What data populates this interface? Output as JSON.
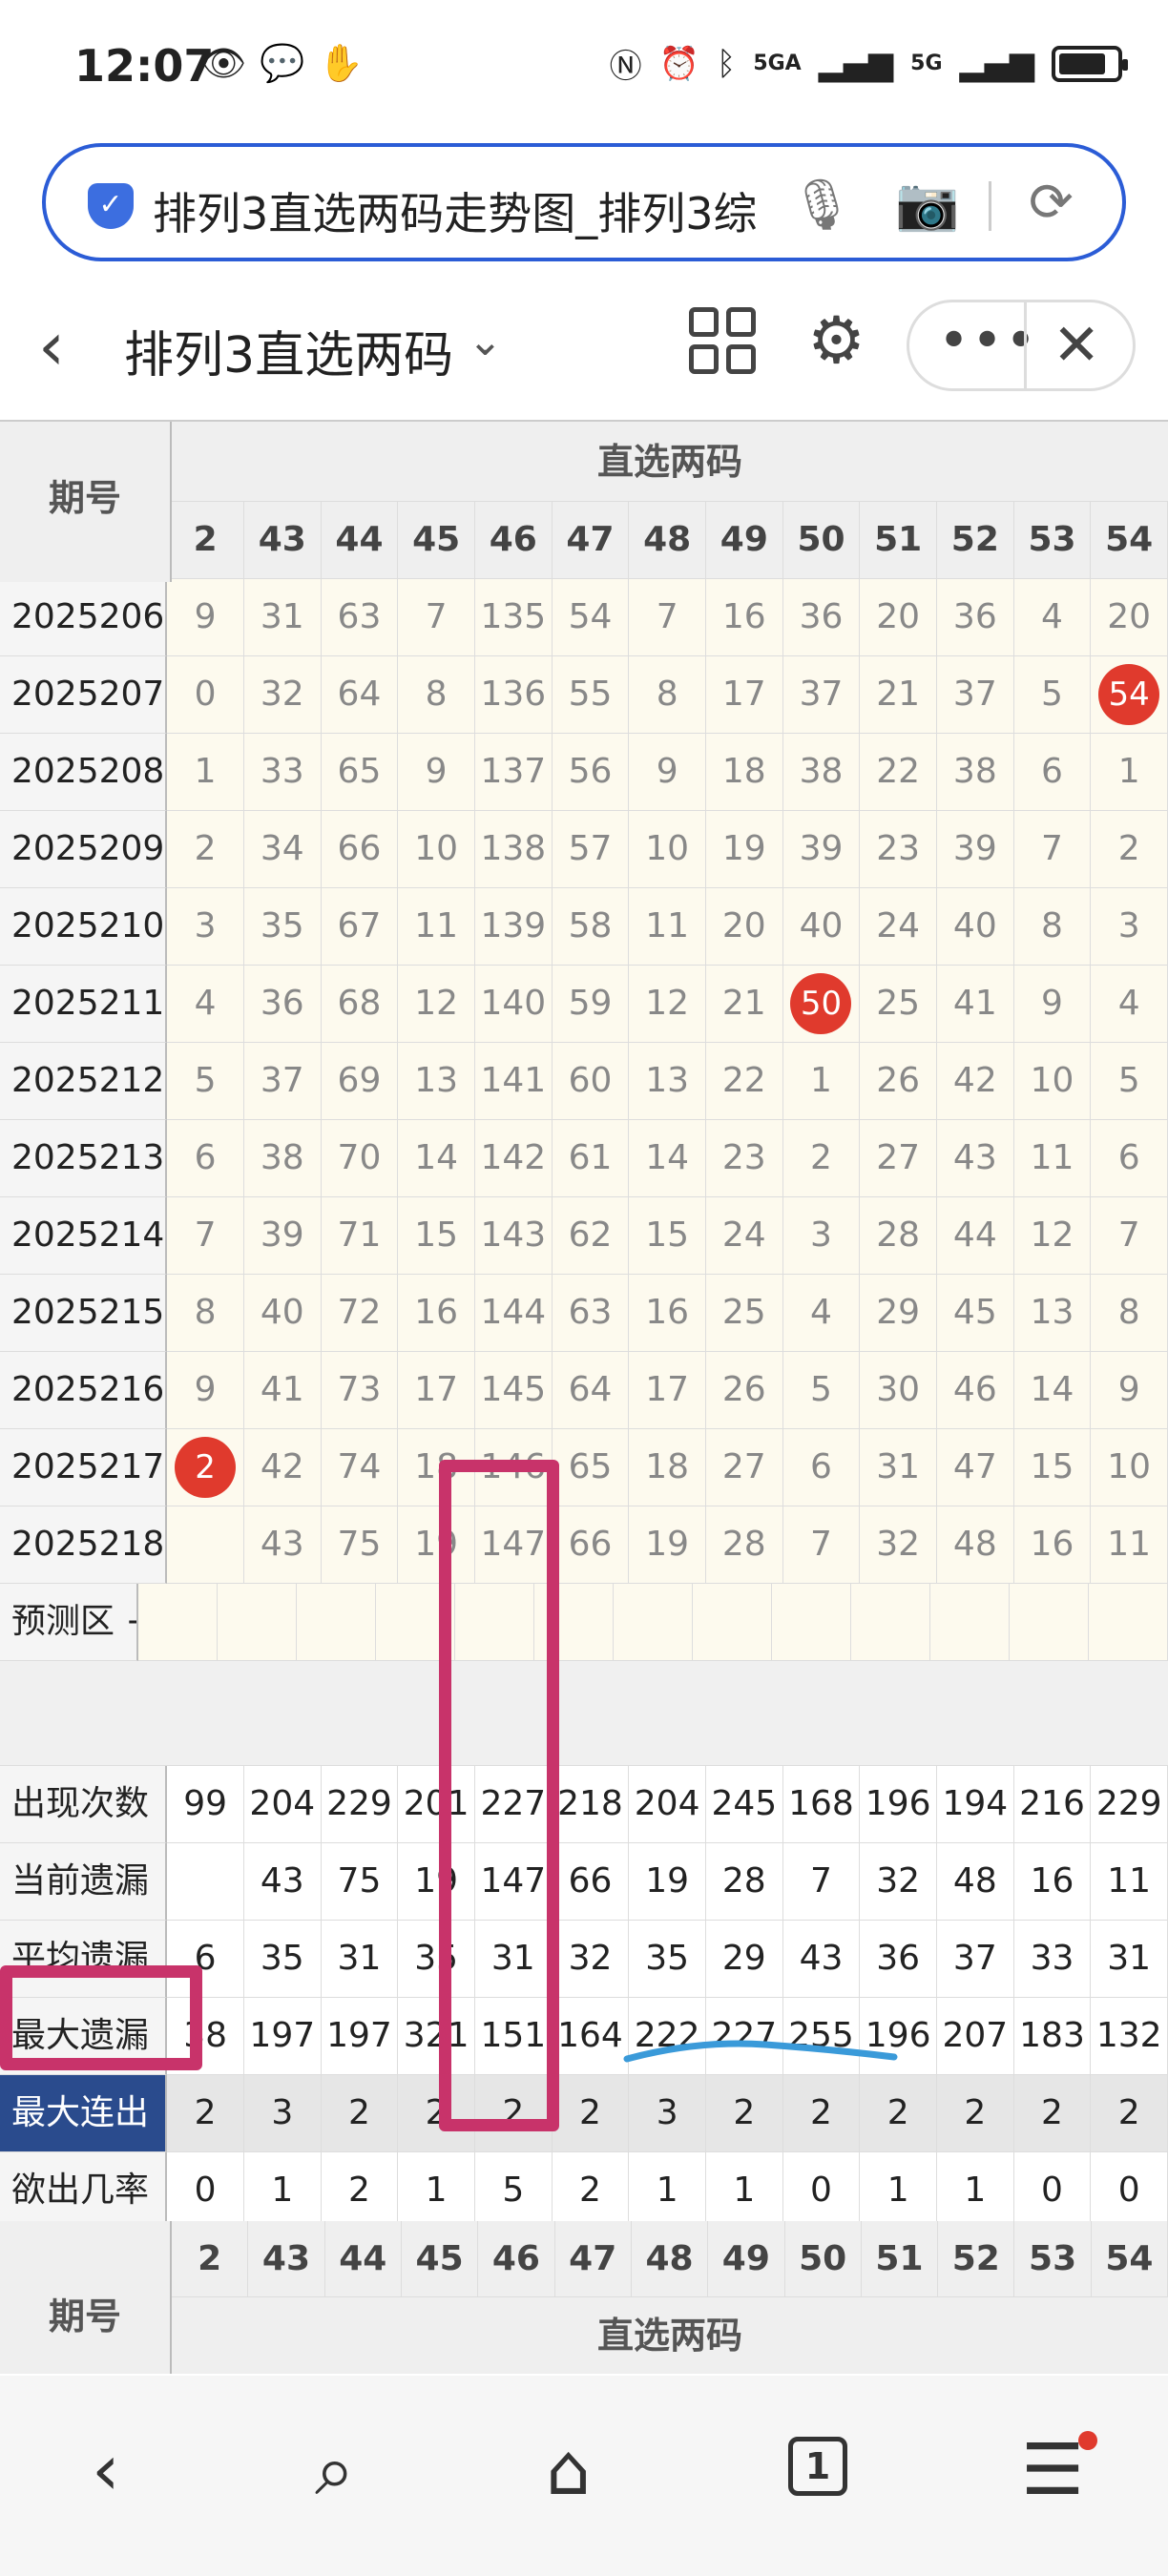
{
  "status_bar": {
    "time": "12:07",
    "sig1": "5GA",
    "sig2": "5G"
  },
  "search_bar": {
    "text": "排列3直选两码走势图_排列3综"
  },
  "header": {
    "title": "排列3直选两码"
  },
  "table": {
    "title": "直选两码",
    "period_label": "期号",
    "columns": [
      "2",
      "43",
      "44",
      "45",
      "46",
      "47",
      "48",
      "49",
      "50",
      "51",
      "52",
      "53",
      "54"
    ],
    "rows": [
      {
        "period": "2025206",
        "cells": [
          "9",
          "31",
          "63",
          "7",
          "135",
          "54",
          "7",
          "16",
          "36",
          "20",
          "36",
          "4",
          "20"
        ]
      },
      {
        "period": "2025207",
        "cells": [
          "0",
          "32",
          "64",
          "8",
          "136",
          "55",
          "8",
          "17",
          "37",
          "21",
          "37",
          "5",
          "54"
        ],
        "hit": 12
      },
      {
        "period": "2025208",
        "cells": [
          "1",
          "33",
          "65",
          "9",
          "137",
          "56",
          "9",
          "18",
          "38",
          "22",
          "38",
          "6",
          "1"
        ]
      },
      {
        "period": "2025209",
        "cells": [
          "2",
          "34",
          "66",
          "10",
          "138",
          "57",
          "10",
          "19",
          "39",
          "23",
          "39",
          "7",
          "2"
        ]
      },
      {
        "period": "2025210",
        "cells": [
          "3",
          "35",
          "67",
          "11",
          "139",
          "58",
          "11",
          "20",
          "40",
          "24",
          "40",
          "8",
          "3"
        ]
      },
      {
        "period": "2025211",
        "cells": [
          "4",
          "36",
          "68",
          "12",
          "140",
          "59",
          "12",
          "21",
          "50",
          "25",
          "41",
          "9",
          "4"
        ],
        "hit": 8
      },
      {
        "period": "2025212",
        "cells": [
          "5",
          "37",
          "69",
          "13",
          "141",
          "60",
          "13",
          "22",
          "1",
          "26",
          "42",
          "10",
          "5"
        ]
      },
      {
        "period": "2025213",
        "cells": [
          "6",
          "38",
          "70",
          "14",
          "142",
          "61",
          "14",
          "23",
          "2",
          "27",
          "43",
          "11",
          "6"
        ]
      },
      {
        "period": "2025214",
        "cells": [
          "7",
          "39",
          "71",
          "15",
          "143",
          "62",
          "15",
          "24",
          "3",
          "28",
          "44",
          "12",
          "7"
        ]
      },
      {
        "period": "2025215",
        "cells": [
          "8",
          "40",
          "72",
          "16",
          "144",
          "63",
          "16",
          "25",
          "4",
          "29",
          "45",
          "13",
          "8"
        ]
      },
      {
        "period": "2025216",
        "cells": [
          "9",
          "41",
          "73",
          "17",
          "145",
          "64",
          "17",
          "26",
          "5",
          "30",
          "46",
          "14",
          "9"
        ]
      },
      {
        "period": "2025217",
        "cells": [
          "2",
          "42",
          "74",
          "18",
          "146",
          "65",
          "18",
          "27",
          "6",
          "31",
          "47",
          "15",
          "10"
        ],
        "hit": 0
      },
      {
        "period": "2025218",
        "cells": [
          "",
          "43",
          "75",
          "19",
          "147",
          "66",
          "19",
          "28",
          "7",
          "32",
          "48",
          "16",
          "11"
        ]
      }
    ],
    "predict_label": "预测区 +",
    "stats": [
      {
        "label": "出现次数",
        "cells": [
          "99",
          "204",
          "229",
          "201",
          "227",
          "218",
          "204",
          "245",
          "168",
          "196",
          "194",
          "216",
          "229"
        ]
      },
      {
        "label": "当前遗漏",
        "cells": [
          "",
          "43",
          "75",
          "19",
          "147",
          "66",
          "19",
          "28",
          "7",
          "32",
          "48",
          "16",
          "11"
        ]
      },
      {
        "label": "平均遗漏",
        "cells": [
          "6",
          "35",
          "31",
          "35",
          "31",
          "32",
          "35",
          "29",
          "43",
          "36",
          "37",
          "33",
          "31"
        ]
      },
      {
        "label": "最大遗漏",
        "cells": [
          "38",
          "197",
          "197",
          "321",
          "151",
          "164",
          "222",
          "227",
          "255",
          "196",
          "207",
          "183",
          "132"
        ]
      },
      {
        "label": "最大连出",
        "cells": [
          "2",
          "3",
          "2",
          "2",
          "2",
          "2",
          "3",
          "2",
          "2",
          "2",
          "2",
          "2",
          "2"
        ]
      },
      {
        "label": "欲出几率",
        "cells": [
          "0",
          "1",
          "2",
          "1",
          "5",
          "2",
          "1",
          "1",
          "0",
          "1",
          "1",
          "0",
          "0"
        ]
      }
    ]
  },
  "nav": {
    "tabs_count": "1"
  }
}
